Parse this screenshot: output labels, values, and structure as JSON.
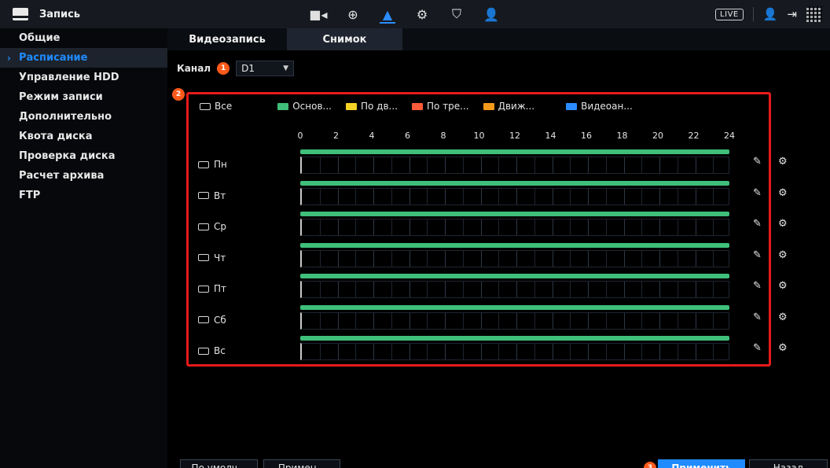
{
  "header": {
    "title": "Запись",
    "live_label": "LIVE"
  },
  "sidebar": {
    "items": [
      {
        "label": "Общие"
      },
      {
        "label": "Расписание",
        "active": true
      },
      {
        "label": "Управление HDD"
      },
      {
        "label": "Режим записи"
      },
      {
        "label": "Дополнительно"
      },
      {
        "label": "Квота диска"
      },
      {
        "label": "Проверка диска"
      },
      {
        "label": "Расчет архива"
      },
      {
        "label": "FTP"
      }
    ]
  },
  "tabs": [
    {
      "label": "Видеозапись",
      "active": false
    },
    {
      "label": "Снимок",
      "active": true
    }
  ],
  "channel": {
    "label": "Канал",
    "value": "D1",
    "badge": "1"
  },
  "schedule": {
    "badge": "2",
    "all_label": "Все",
    "legend": [
      {
        "label": "Основ...",
        "color": "#3fbf7a",
        "checked": true
      },
      {
        "label": "По дв...",
        "color": "#f4d225"
      },
      {
        "label": "По тре...",
        "color": "#ff5a3a"
      },
      {
        "label": "Движ...",
        "color": "#f49a1a"
      },
      {
        "label": "Видеоан...",
        "color": "#2b8cff"
      }
    ],
    "ticks": [
      "0",
      "2",
      "4",
      "6",
      "8",
      "10",
      "12",
      "14",
      "16",
      "18",
      "20",
      "22",
      "24"
    ],
    "days": [
      {
        "label": "Пн",
        "start": 0,
        "end": 24
      },
      {
        "label": "Вт",
        "start": 0,
        "end": 24
      },
      {
        "label": "Ср",
        "start": 0,
        "end": 24
      },
      {
        "label": "Чт",
        "start": 0,
        "end": 24
      },
      {
        "label": "Пт",
        "start": 0,
        "end": 24
      },
      {
        "label": "Сб",
        "start": 0,
        "end": 24
      },
      {
        "label": "Вс",
        "start": 0,
        "end": 24
      }
    ]
  },
  "footer": {
    "default_label": "По умолч...",
    "copy_label": "Примен...",
    "apply_badge": "3",
    "apply_label": "Применить",
    "back_label": "Назад"
  },
  "colors": {
    "accent": "#1f8bff",
    "highlight_frame": "#e51a1a",
    "badge": "#ff5a1a",
    "schedule_bar": "#3fbf7a"
  }
}
